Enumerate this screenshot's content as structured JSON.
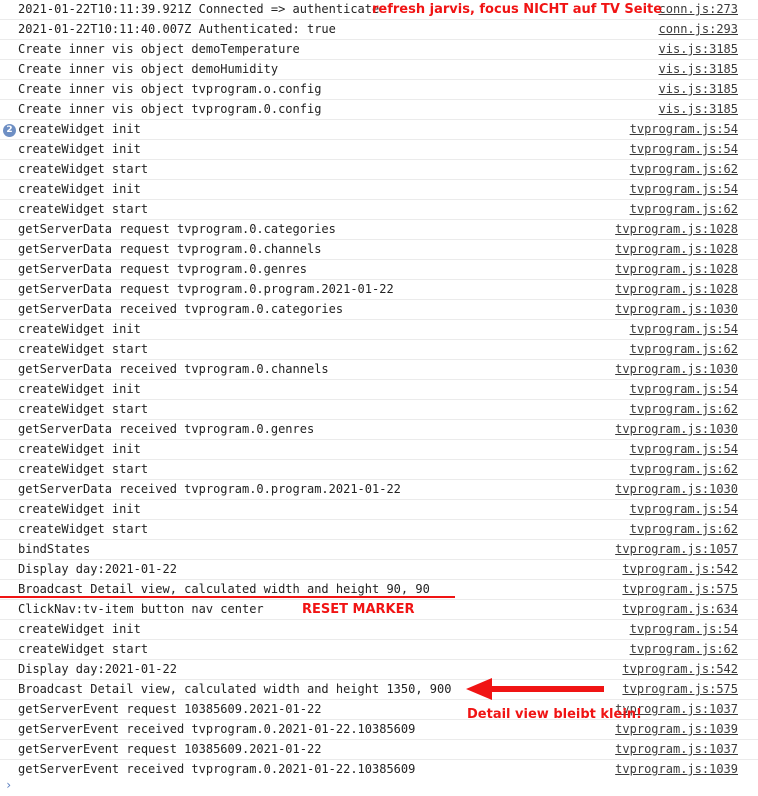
{
  "console": {
    "prompt_chevron": "›",
    "prompt_value": "",
    "prompt_placeholder": "",
    "rows": [
      {
        "badge": null,
        "message": "2021-01-22T10:11:39.921Z Connected => authenticate",
        "source": "conn.js:273"
      },
      {
        "badge": null,
        "message": "2021-01-22T10:11:40.007Z Authenticated: true",
        "source": "conn.js:293"
      },
      {
        "badge": null,
        "message": "Create inner vis object demoTemperature",
        "source": "vis.js:3185"
      },
      {
        "badge": null,
        "message": "Create inner vis object demoHumidity",
        "source": "vis.js:3185"
      },
      {
        "badge": null,
        "message": "Create inner vis object tvprogram.o.config",
        "source": "vis.js:3185"
      },
      {
        "badge": null,
        "message": "Create inner vis object tvprogram.0.config",
        "source": "vis.js:3185"
      },
      {
        "badge": "2",
        "message": "createWidget init",
        "source": "tvprogram.js:54"
      },
      {
        "badge": null,
        "message": "createWidget init",
        "source": "tvprogram.js:54"
      },
      {
        "badge": null,
        "message": "createWidget start",
        "source": "tvprogram.js:62"
      },
      {
        "badge": null,
        "message": "createWidget init",
        "source": "tvprogram.js:54"
      },
      {
        "badge": null,
        "message": "createWidget start",
        "source": "tvprogram.js:62"
      },
      {
        "badge": null,
        "message": "getServerData request tvprogram.0.categories",
        "source": "tvprogram.js:1028"
      },
      {
        "badge": null,
        "message": "getServerData request tvprogram.0.channels",
        "source": "tvprogram.js:1028"
      },
      {
        "badge": null,
        "message": "getServerData request tvprogram.0.genres",
        "source": "tvprogram.js:1028"
      },
      {
        "badge": null,
        "message": "getServerData request tvprogram.0.program.2021-01-22",
        "source": "tvprogram.js:1028"
      },
      {
        "badge": null,
        "message": "getServerData received tvprogram.0.categories",
        "source": "tvprogram.js:1030"
      },
      {
        "badge": null,
        "message": "createWidget init",
        "source": "tvprogram.js:54"
      },
      {
        "badge": null,
        "message": "createWidget start",
        "source": "tvprogram.js:62"
      },
      {
        "badge": null,
        "message": "getServerData received tvprogram.0.channels",
        "source": "tvprogram.js:1030"
      },
      {
        "badge": null,
        "message": "createWidget init",
        "source": "tvprogram.js:54"
      },
      {
        "badge": null,
        "message": "createWidget start",
        "source": "tvprogram.js:62"
      },
      {
        "badge": null,
        "message": "getServerData received tvprogram.0.genres",
        "source": "tvprogram.js:1030"
      },
      {
        "badge": null,
        "message": "createWidget init",
        "source": "tvprogram.js:54"
      },
      {
        "badge": null,
        "message": "createWidget start",
        "source": "tvprogram.js:62"
      },
      {
        "badge": null,
        "message": "getServerData received tvprogram.0.program.2021-01-22",
        "source": "tvprogram.js:1030"
      },
      {
        "badge": null,
        "message": "createWidget init",
        "source": "tvprogram.js:54"
      },
      {
        "badge": null,
        "message": "createWidget start",
        "source": "tvprogram.js:62"
      },
      {
        "badge": null,
        "message": "bindStates",
        "source": "tvprogram.js:1057"
      },
      {
        "badge": null,
        "message": "Display day:2021-01-22",
        "source": "tvprogram.js:542"
      },
      {
        "badge": null,
        "message": "Broadcast Detail view, calculated width and height 90, 90",
        "source": "tvprogram.js:575"
      },
      {
        "badge": null,
        "message": "ClickNav:tv-item button nav center",
        "source": "tvprogram.js:634"
      },
      {
        "badge": null,
        "message": "createWidget init",
        "source": "tvprogram.js:54"
      },
      {
        "badge": null,
        "message": "createWidget start",
        "source": "tvprogram.js:62"
      },
      {
        "badge": null,
        "message": "Display day:2021-01-22",
        "source": "tvprogram.js:542"
      },
      {
        "badge": null,
        "message": "Broadcast Detail view, calculated width and height 1350, 900",
        "source": "tvprogram.js:575"
      },
      {
        "badge": null,
        "message": "getServerEvent request 10385609.2021-01-22",
        "source": "tvprogram.js:1037"
      },
      {
        "badge": null,
        "message": "getServerEvent received tvprogram.0.2021-01-22.10385609",
        "source": "tvprogram.js:1039"
      },
      {
        "badge": null,
        "message": "getServerEvent request 10385609.2021-01-22",
        "source": "tvprogram.js:1037"
      },
      {
        "badge": null,
        "message": "getServerEvent received tvprogram.0.2021-01-22.10385609",
        "source": "tvprogram.js:1039"
      }
    ]
  },
  "annotations": {
    "color": "#f01414",
    "top_note": "refresh jarvis, focus NICHT auf TV Seite",
    "reset_marker": "RESET MARKER",
    "detail_note": "Detail view bleibt klein!"
  }
}
